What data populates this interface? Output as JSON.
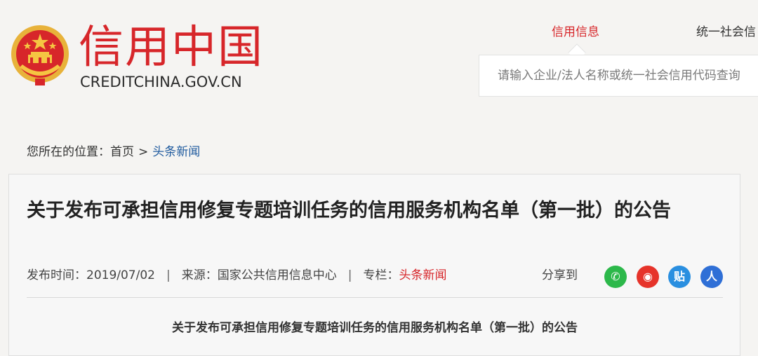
{
  "header": {
    "logo_cn": "信用中国",
    "logo_en": "CREDITCHINA.GOV.CN",
    "nav": {
      "active": "信用信息",
      "other": "统一社会信"
    },
    "search": {
      "placeholder": "请输入企业/法人名称或统一社会信用代码查询"
    }
  },
  "breadcrumb": {
    "prefix": "您所在的位置：",
    "home": "首页",
    "separator": ">",
    "current": "头条新闻"
  },
  "article": {
    "title": "关于发布可承担信用修复专题培训任务的信用服务机构名单（第一批）的公告",
    "meta": {
      "publish_label": "发布时间：",
      "publish_date": "2019/07/02",
      "separator": "|",
      "source_label": "来源：",
      "source": "国家公共信用信息中心",
      "column_label": "专栏：",
      "column": "头条新闻"
    },
    "share": {
      "label": "分享到",
      "icons": [
        {
          "name": "wechat",
          "glyph": "✆",
          "color": "#2cb84a"
        },
        {
          "name": "weibo",
          "glyph": "◉",
          "color": "#e6332a"
        },
        {
          "name": "tieba",
          "glyph": "贴",
          "color": "#2a8fe0"
        },
        {
          "name": "renren",
          "glyph": "人",
          "color": "#2f6fd6"
        }
      ]
    },
    "subtitle": "关于发布可承担信用修复专题培训任务的信用服务机构名单（第一批）的公告"
  }
}
